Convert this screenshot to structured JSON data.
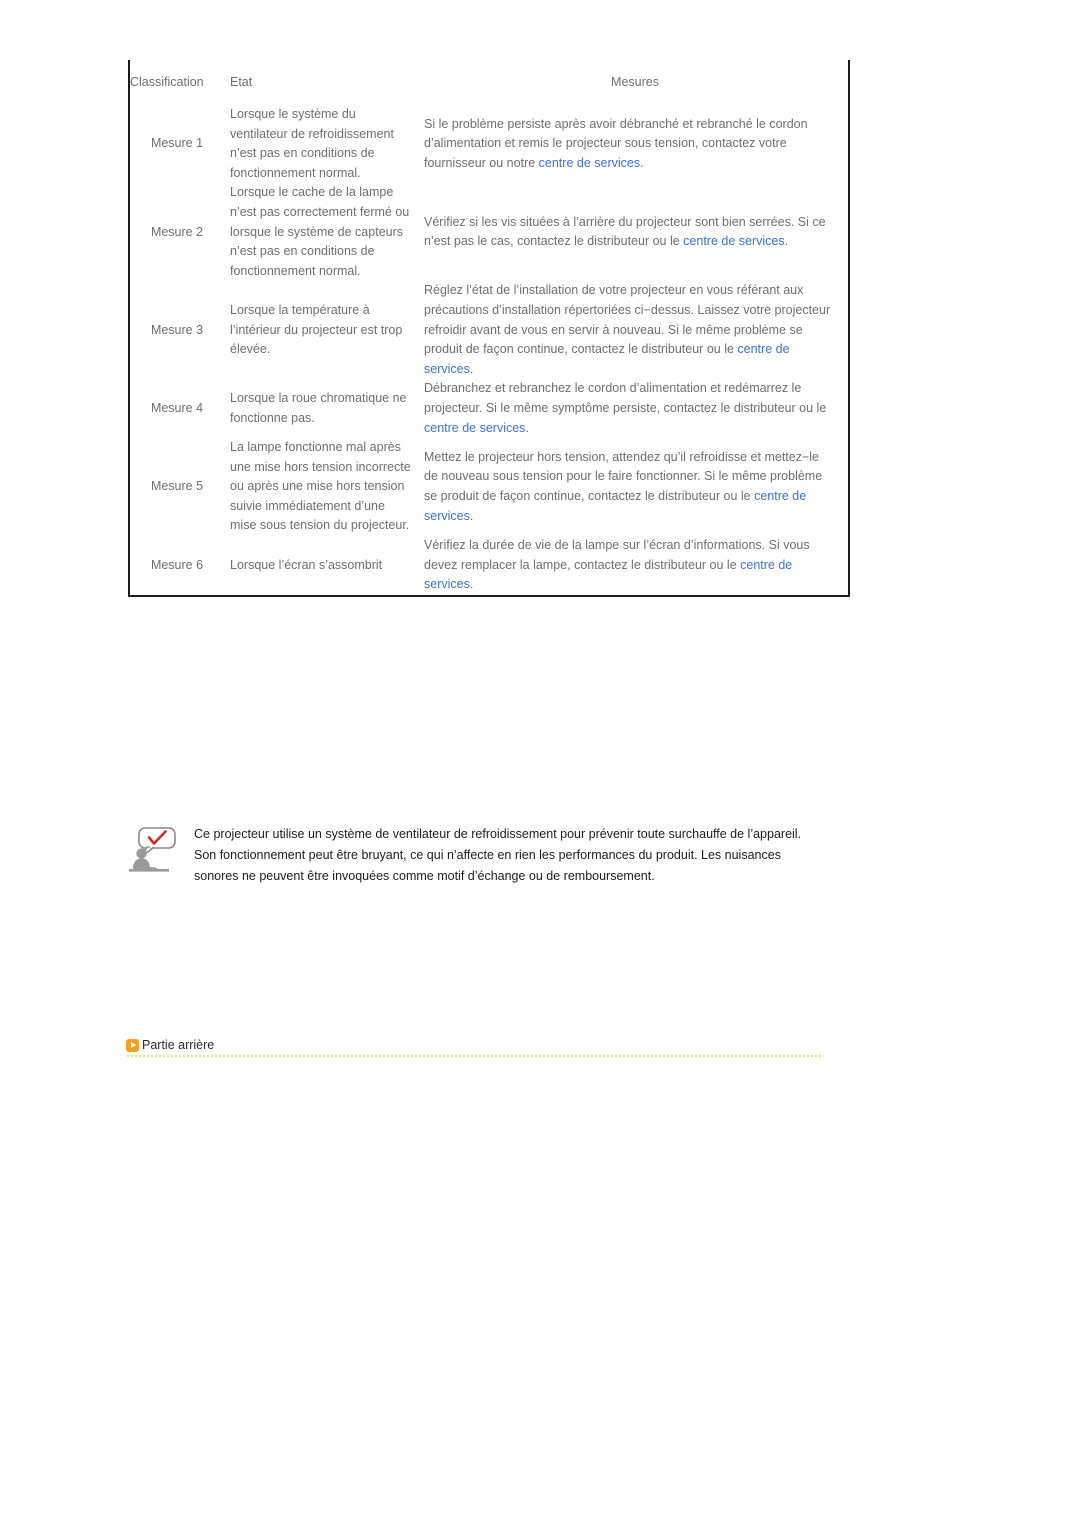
{
  "table": {
    "headers": {
      "classification": "Classification",
      "etat": "Etat",
      "mesures": "Mesures"
    },
    "link_label": "centre de services",
    "link_color": "#3a72d8",
    "rows": [
      {
        "classification": "Mesure 1",
        "etat": "Lorsque le système du ventilateur de refroidissement n’est pas en conditions de fonctionnement normal.",
        "mesures_before": "Si le problème persiste après avoir débranché et rebranché le cordon d’alimentation et remis le projecteur sous tension, contactez votre fournisseur ou notre ",
        "mesures_link": "centre de services",
        "mesures_after": "."
      },
      {
        "classification": "Mesure 2",
        "etat": "Lorsque le cache de la lampe n’est pas correctement fermé ou lorsque le système de capteurs n’est pas en conditions de fonctionnement normal.",
        "mesures_before": "Vérifiez si les vis situées à l’arrière du projecteur sont bien serrées. Si ce n’est pas le cas, contactez le distributeur ou le ",
        "mesures_link": "centre de services",
        "mesures_after": "."
      },
      {
        "classification": "Mesure 3",
        "etat": "Lorsque la température à l’intérieur du projecteur est trop élevée.",
        "mesures_before": "Réglez l’état de l’installation de votre projecteur en vous référant aux précautions d’installation répertoriées ci−dessus. Laissez votre projecteur refroidir avant de vous en servir à nouveau. Si le même problème se produit de façon continue, contactez le distributeur ou le ",
        "mesures_link": "centre de services",
        "mesures_after": "."
      },
      {
        "classification": "Mesure 4",
        "etat": "Lorsque la roue chromatique ne fonctionne pas.",
        "mesures_before": "Débranchez et rebranchez le cordon d’alimentation et redémarrez le projecteur. Si le même symptôme persiste, contactez le distributeur ou le ",
        "mesures_link": "centre de services",
        "mesures_after": "."
      },
      {
        "classification": "Mesure 5",
        "etat": "La lampe fonctionne mal après une mise hors tension incorrecte ou après une mise hors tension suivie immédiatement d’une mise sous tension du projecteur.",
        "mesures_before": "Mettez le projecteur hors tension, attendez qu’il refroidisse et mettez−le de nouveau sous tension pour le faire fonctionner. Si le même problème se produit de façon continue, contactez le distributeur ou le ",
        "mesures_link": "centre de services",
        "mesures_after": "."
      },
      {
        "classification": "Mesure 6",
        "etat": "Lorsque l’écran s’assombrit",
        "mesures_before": "Vérifiez la durée de vie de la lampe sur l’écran d’informations. Si vous devez remplacer la lampe, contactez le distributeur ou le ",
        "mesures_link": "centre de services",
        "mesures_after": "."
      }
    ]
  },
  "note": {
    "icon": "person-speech-bubble-check-icon",
    "lines": [
      "Ce projecteur utilise un système de ventilateur de refroidissement pour prévenir toute surchauffe de l’appareil.",
      "Son fonctionnement peut être bruyant, ce qui n’affecte en rien les performances du produit. Les nuisances",
      "sonores ne peuvent être invoquées comme motif d’échange ou de remboursement."
    ]
  },
  "section": {
    "arrow_icon": "chevron-right-icon",
    "title": "Partie arrière",
    "accent_color": "#f5a01e",
    "rule_color": "#d6ee7a"
  }
}
